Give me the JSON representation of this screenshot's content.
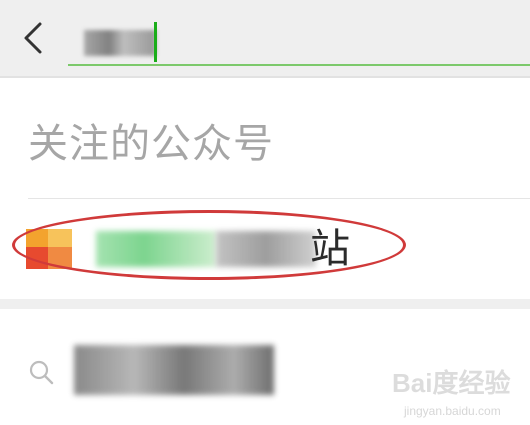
{
  "header": {
    "back_icon": "chevron-left-icon",
    "search_value": "",
    "accent_color": "#1aad19"
  },
  "section": {
    "title": "关注的公众号"
  },
  "account": {
    "name_suffix": "站",
    "annotation_color": "#d03a3a"
  },
  "search_suggestion": {
    "icon": "search-icon"
  },
  "watermark": {
    "logo": "Bai度经验",
    "url": "jingyan.baidu.com"
  }
}
